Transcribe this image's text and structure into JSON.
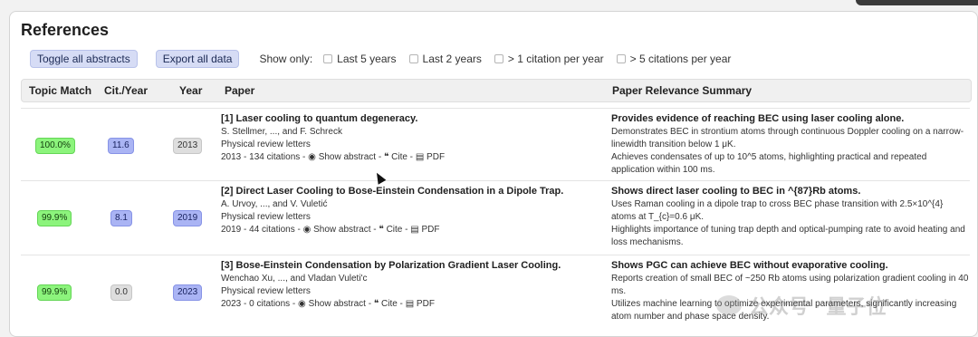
{
  "title": "References",
  "toolbar": {
    "toggle_label": "Toggle all abstracts",
    "export_label": "Export all data",
    "show_only": "Show only:",
    "filters": [
      "Last 5 years",
      "Last 2 years",
      "> 1 citation per year",
      "> 5 citations per year"
    ]
  },
  "columns": {
    "topic": "Topic Match",
    "cit": "Cit./Year",
    "year": "Year",
    "paper": "Paper",
    "summary": "Paper Relevance Summary"
  },
  "rows": [
    {
      "topic": "100.0%",
      "cit": "11.6",
      "year": "2013",
      "title": "[1] Laser cooling to quantum degeneracy.",
      "authors": "S. Stellmer, ..., and F. Schreck",
      "journal": "Physical review letters",
      "citations": "2013 - 134 citations -",
      "show_abstract": "Show abstract -",
      "cite": "Cite -",
      "pdf": "PDF",
      "summary_title": "Provides evidence of reaching BEC using laser cooling alone.",
      "summary_1": "Demonstrates BEC in strontium atoms through continuous Doppler cooling on a narrow-linewidth transition below 1 μK.",
      "summary_2": "Achieves condensates of up to 10^5 atoms, highlighting practical and repeated application within 100 ms."
    },
    {
      "topic": "99.9%",
      "cit": "8.1",
      "year": "2019",
      "title": "[2] Direct Laser Cooling to Bose-Einstein Condensation in a Dipole Trap.",
      "authors": "A. Urvoy, ..., and V. Vuletić",
      "journal": "Physical review letters",
      "citations": "2019 - 44 citations -",
      "show_abstract": "Show abstract -",
      "cite": "Cite -",
      "pdf": "PDF",
      "summary_title": "Shows direct laser cooling to BEC in ^{87}Rb atoms.",
      "summary_1": "Uses Raman cooling in a dipole trap to cross BEC phase transition with 2.5×10^{4} atoms at T_{c}=0.6 μK.",
      "summary_2": "Highlights importance of tuning trap depth and optical-pumping rate to avoid heating and loss mechanisms."
    },
    {
      "topic": "99.9%",
      "cit": "0.0",
      "year": "2023",
      "title": "[3] Bose-Einstein Condensation by Polarization Gradient Laser Cooling.",
      "authors": "Wenchao Xu, ..., and Vladan Vuleti'c",
      "journal": "Physical review letters",
      "citations": "2023 - 0 citations -",
      "show_abstract": "Show abstract -",
      "cite": "Cite -",
      "pdf": "PDF",
      "summary_title": "Shows PGC can achieve BEC without evaporative cooling.",
      "summary_1": "Reports creation of small BEC of ~250 Rb atoms using polarization gradient cooling in 40 ms.",
      "summary_2": "Utilizes machine learning to optimize experimental parameters, significantly increasing atom number and phase space density."
    }
  ],
  "watermark": "公众号 · 量子位",
  "colors": {
    "green_badge": "#8cf47c",
    "blue_badge": "#aab4f4",
    "gray_badge": "#dedede",
    "button_bg": "#d6dcf5"
  }
}
